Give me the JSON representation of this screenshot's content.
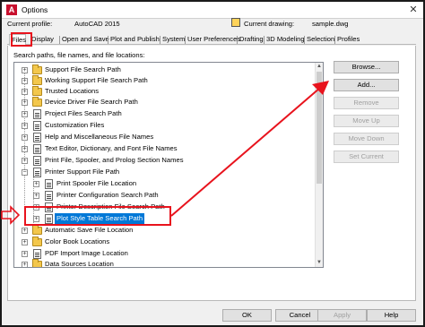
{
  "window": {
    "title": "Options",
    "app_icon": "A"
  },
  "profile": {
    "current_profile_label": "Current profile:",
    "current_profile_value": "AutoCAD 2015",
    "current_drawing_label": "Current drawing:",
    "current_drawing_value": "sample.dwg"
  },
  "tabs": [
    "Files",
    "Display",
    "Open and Save",
    "Plot and Publish",
    "System",
    "User Preferences",
    "Drafting",
    "3D Modeling",
    "Selection",
    "Profiles"
  ],
  "panel_label": "Search paths, file names, and file locations:",
  "tree": [
    {
      "label": "Support File Search Path",
      "icon": "folder-icon",
      "expander": "+"
    },
    {
      "label": "Working Support File Search Path",
      "icon": "folder-icon",
      "expander": "+"
    },
    {
      "label": "Trusted Locations",
      "icon": "folder-icon",
      "expander": "+"
    },
    {
      "label": "Device Driver File Search Path",
      "icon": "folder-icon",
      "expander": "+"
    },
    {
      "label": "Project Files Search Path",
      "icon": "document-icon",
      "expander": "+"
    },
    {
      "label": "Customization Files",
      "icon": "document-icon",
      "expander": "+"
    },
    {
      "label": "Help and Miscellaneous File Names",
      "icon": "document-icon",
      "expander": "+"
    },
    {
      "label": "Text Editor, Dictionary, and Font File Names",
      "icon": "document-icon",
      "expander": "+"
    },
    {
      "label": "Print File, Spooler, and Prolog Section Names",
      "icon": "document-icon",
      "expander": "+"
    },
    {
      "label": "Printer Support File Path",
      "icon": "document-icon",
      "expander": "−"
    },
    {
      "label": "Print Spooler File Location",
      "icon": "document-icon",
      "expander": "+"
    },
    {
      "label": "Printer Configuration Search Path",
      "icon": "document-icon",
      "expander": "+"
    },
    {
      "label": "Printer Description File Search Path",
      "icon": "document-icon",
      "expander": "+"
    },
    {
      "label": "Plot Style Table Search Path",
      "icon": "document-icon",
      "expander": "+"
    },
    {
      "label": "Automatic Save File Location",
      "icon": "folder-icon",
      "expander": "+"
    },
    {
      "label": "Color Book Locations",
      "icon": "folder-icon",
      "expander": "+"
    },
    {
      "label": "PDF Import Image Location",
      "icon": "document-icon",
      "expander": "+"
    },
    {
      "label": "Data Sources Location",
      "icon": "folder-icon",
      "expander": "+"
    }
  ],
  "side_buttons": {
    "browse": "Browse...",
    "add": "Add...",
    "remove": "Remove",
    "move_up": "Move Up",
    "move_down": "Move Down",
    "set_current": "Set Current"
  },
  "bottom_buttons": {
    "ok": "OK",
    "cancel": "Cancel",
    "apply": "Apply",
    "help": "Help"
  },
  "colors": {
    "annotation_red": "#e8131d",
    "selection_blue": "#0078d7"
  }
}
